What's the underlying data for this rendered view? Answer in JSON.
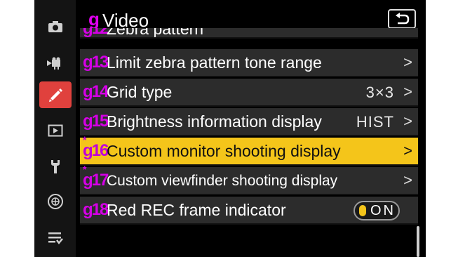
{
  "header": {
    "menu_letter": "g",
    "title": "Video"
  },
  "sidebar": {
    "items": [
      {
        "icon": "camera-icon",
        "active": false
      },
      {
        "icon": "movie-camera-icon",
        "active": false
      },
      {
        "icon": "pencil-icon",
        "active": true
      },
      {
        "icon": "playback-icon",
        "active": false
      },
      {
        "icon": "wrench-icon",
        "active": false
      },
      {
        "icon": "network-icon",
        "active": false
      },
      {
        "icon": "my-menu-icon",
        "active": false
      }
    ]
  },
  "menu": {
    "partial_row": {
      "code": "g12",
      "label": "Zebra pattern"
    },
    "rows": [
      {
        "code": "g13",
        "starred": false,
        "label": "Limit zebra pattern tone range",
        "value": "",
        "chevron": ">"
      },
      {
        "code": "g14",
        "starred": false,
        "label": "Grid type",
        "value": "3×3",
        "chevron": ">"
      },
      {
        "code": "g15",
        "starred": false,
        "label": "Brightness information display",
        "value": "HIST",
        "chevron": ">"
      },
      {
        "code": "g16",
        "starred": true,
        "star": "*",
        "label": "Custom monitor shooting display",
        "value": "",
        "chevron": ">",
        "selected": true
      },
      {
        "code": "g17",
        "starred": true,
        "star": "*",
        "label": "Custom viewfinder shooting display",
        "value": "",
        "chevron": ">"
      },
      {
        "code": "g18",
        "starred": false,
        "label": "Red REC frame indicator",
        "toggle": "ON"
      }
    ]
  },
  "colors": {
    "accent_magenta": "#e000f0",
    "selected_row": "#f4c51a",
    "active_tab": "#e0413d",
    "row_bg": "#2c2c2c"
  }
}
